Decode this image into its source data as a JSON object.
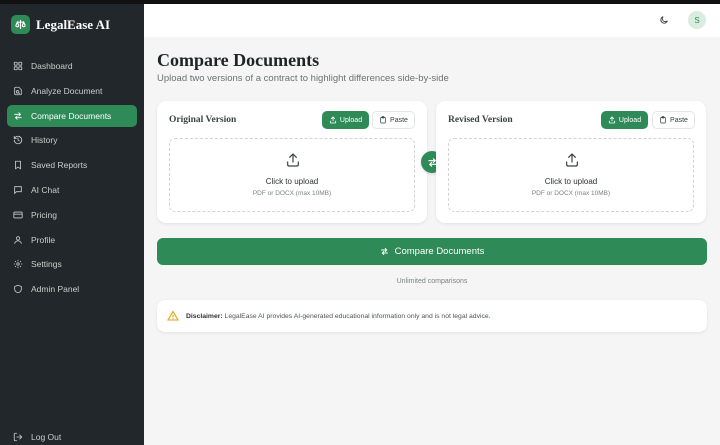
{
  "app": {
    "name": "LegalEase AI"
  },
  "sidebar": {
    "items": [
      {
        "label": "Dashboard",
        "icon": "dashboard-icon",
        "active": false
      },
      {
        "label": "Analyze Document",
        "icon": "analyze-icon",
        "active": false
      },
      {
        "label": "Compare Documents",
        "icon": "compare-icon",
        "active": true
      },
      {
        "label": "History",
        "icon": "history-icon",
        "active": false
      },
      {
        "label": "Saved Reports",
        "icon": "bookmark-icon",
        "active": false
      },
      {
        "label": "AI Chat",
        "icon": "chat-icon",
        "active": false
      },
      {
        "label": "Pricing",
        "icon": "card-icon",
        "active": false
      },
      {
        "label": "Profile",
        "icon": "user-icon",
        "active": false
      },
      {
        "label": "Settings",
        "icon": "gear-icon",
        "active": false
      },
      {
        "label": "Admin Panel",
        "icon": "shield-icon",
        "active": false
      }
    ],
    "logout_label": "Log Out"
  },
  "topbar": {
    "avatar_initial": "S"
  },
  "page": {
    "title": "Compare Documents",
    "subtitle": "Upload two versions of a contract to highlight differences side-by-side"
  },
  "original": {
    "title": "Original Version",
    "upload_label": "Upload",
    "paste_label": "Paste",
    "drop_title": "Click to upload",
    "drop_hint": "PDF or DOCX (max 10MB)"
  },
  "revised": {
    "title": "Revised Version",
    "upload_label": "Upload",
    "paste_label": "Paste",
    "drop_title": "Click to upload",
    "drop_hint": "PDF or DOCX (max 10MB)"
  },
  "compare_button_label": "Compare Documents",
  "usage_note": "Unlimited comparisons",
  "disclaimer": {
    "label": "Disclaimer:",
    "text": "LegalEase AI provides AI-generated educational information only and is not legal advice."
  },
  "colors": {
    "accent": "#2e8b57",
    "sidebar_bg": "#22272b",
    "warning": "#e0a21a"
  }
}
